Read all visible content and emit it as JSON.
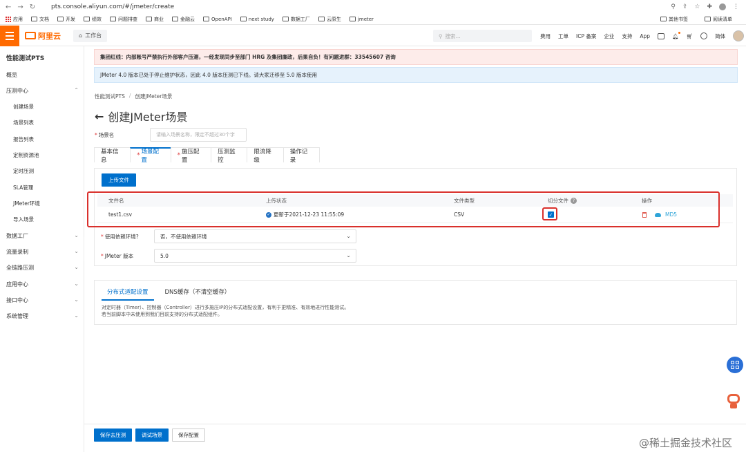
{
  "browser": {
    "url": "pts.console.aliyun.com/#/jmeter/create",
    "bookmarks": [
      "应用",
      "文档",
      "开发",
      "绩效",
      "问题排查",
      "商业",
      "金融云",
      "OpenAPI",
      "next study",
      "数据工厂",
      "云原生",
      "jmeter"
    ],
    "bookmarks_right": [
      "其他书签",
      "阅读清单"
    ]
  },
  "topbar": {
    "brand": "阿里云",
    "workbench": "工作台",
    "search_placeholder": "搜索...",
    "nav": [
      "费用",
      "工单",
      "ICP 备案",
      "企业",
      "支持",
      "App"
    ],
    "lang": "简体"
  },
  "sidebar": {
    "title": "性能测试PTS",
    "overview": "概览",
    "pressure_center": "压测中心",
    "pressure_items": [
      "创建场景",
      "场景列表",
      "报告列表",
      "定制资源池",
      "定时压测",
      "SLA管理",
      "JMeter环境",
      "导入场景"
    ],
    "groups": [
      "数据工厂",
      "流量录制",
      "全链路压测",
      "应用中心",
      "接口中心",
      "系统管理"
    ]
  },
  "alerts": {
    "red": "集团红线：内部账号严禁执行外部客户压测，一经发现同步至部门 HRG 及集团廉政，后果自负！有问题进群：33545607 咨询",
    "blue": "JMeter 4.0 版本已处于停止维护状态，因此 4.0 版本压测已下线。请大家迁移至 5.0 版本使用"
  },
  "breadcrumb": [
    "性能测试PTS",
    "创建JMeter场景"
  ],
  "page_title": "创建JMeter场景",
  "scene_name": {
    "label": "场景名",
    "placeholder": "请输入场景名称，限定不超过30个字"
  },
  "tabs": [
    {
      "label": "基本信息",
      "required": false
    },
    {
      "label": "场景配置",
      "required": true
    },
    {
      "label": "施压配置",
      "required": true
    },
    {
      "label": "压测监控",
      "required": false
    },
    {
      "label": "限流降级",
      "required": false
    },
    {
      "label": "操作记录",
      "required": false
    }
  ],
  "upload_button": "上传文件",
  "table": {
    "headers": [
      "文件名",
      "上传状态",
      "文件类型",
      "切分文件",
      "操作"
    ],
    "rows": [
      {
        "name": "test1.csv",
        "status": "更新于2021-12-23 11:55:09",
        "type": "CSV",
        "split": true,
        "md5": "MD5"
      }
    ]
  },
  "dependency_env": {
    "label": "使用依赖环境?",
    "value": "否，不使用依赖环境"
  },
  "jmeter_version": {
    "label": "JMeter 版本",
    "value": "5.0"
  },
  "distributed": {
    "tabs": [
      "分布式适配设置",
      "DNS缓存（不清空缓存）"
    ],
    "desc_line1": "对定时器（Timer）、控制器（Controller）进行多施压IP的分布式适配设置，有利于更精准、有效地进行性能测试。",
    "desc_line2": "若当前脚本中未使用到我们目前支持的分布式适配组件。"
  },
  "footer": {
    "buttons": [
      "保存去压测",
      "调试场景",
      "保存配置"
    ],
    "watermark": "@稀土掘金技术社区"
  },
  "colors": {
    "brand": "#ff6a00",
    "primary": "#0070cc",
    "highlight": "#d9302c"
  }
}
